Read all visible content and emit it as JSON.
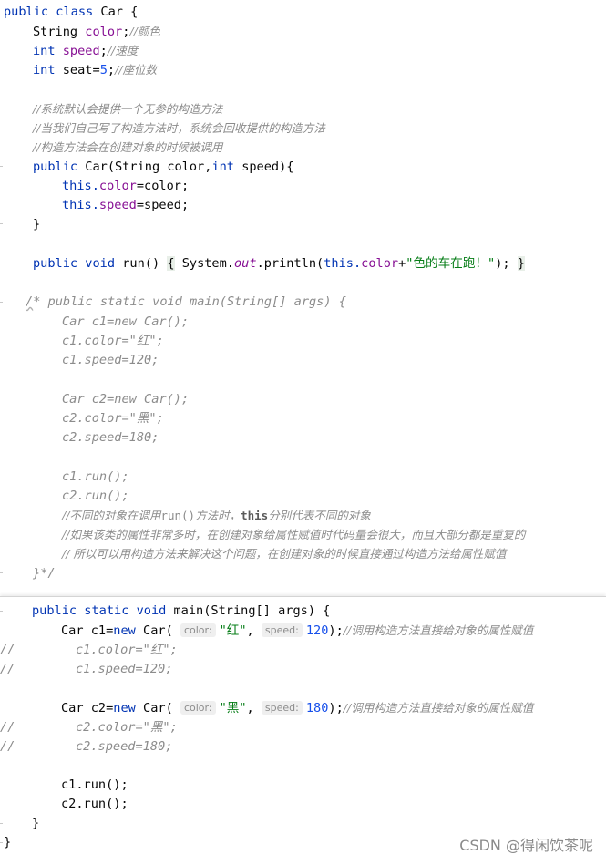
{
  "top": {
    "l1": {
      "a": "public class ",
      "b": "Car {"
    },
    "l2": {
      "a": "String ",
      "b": "color",
      "c": ";",
      "d": "//颜色"
    },
    "l3": {
      "a": "int ",
      "b": "speed",
      "c": ";",
      "d": "//速度"
    },
    "l4": {
      "a": "int ",
      "b": "seat",
      "c": "=",
      "d": "5",
      "e": ";",
      "f": "//座位数"
    },
    "l5": "//系统默认会提供一个无参的构造方法",
    "l6": "//当我们自己写了构造方法时，系统会回收提供的构造方法",
    "l7": "//构造方法会在创建对象的时候被调用",
    "l8": {
      "a": "public ",
      "b": "Car(String color,",
      "c": "int ",
      "d": "speed){"
    },
    "l9": {
      "a": "this.",
      "b": "color",
      "c": "=color;"
    },
    "l10": {
      "a": "this.",
      "b": "speed",
      "c": "=speed;"
    },
    "l11": "}",
    "l12": {
      "a": "public void ",
      "b": "run() ",
      "c": "{",
      "d": " System.",
      "e": "out",
      "f": ".println(",
      "g": "this.",
      "h": "color",
      "i": "+",
      "j": "\"色的车在跑！\"",
      "k": "); ",
      "l": "}"
    },
    "l13": {
      "a": "/",
      "b": "* public static void main(String[] args) {"
    },
    "c1": "Car c1=new Car();",
    "c2": "c1.color=\"红\";",
    "c3": "c1.speed=120;",
    "c4": "Car c2=new Car();",
    "c5": "c2.color=\"黑\";",
    "c6": "c2.speed=180;",
    "c7": "c1.run();",
    "c8": "c2.run();",
    "c9": {
      "a": "//不同的对象在调用",
      "b": "run()",
      "c": "方法时，",
      "d": "this",
      "e": "分别代表不同的对象"
    },
    "c10": "//如果该类的属性非常多时，在创建对象给属性赋值时代码量会很大，而且大部分都是重复的",
    "c11": "// 所以可以用构造方法来解决这个问题，在创建对象的时候直接通过构造方法给属性赋值",
    "c12": "}*/"
  },
  "bottom": {
    "b1": {
      "a": "public static void ",
      "b": "main(String[] args) {"
    },
    "b2": {
      "a": "Car c1=",
      "b": "new ",
      "c": "Car( ",
      "h1": "color:",
      "d": "\"红\"",
      "e": ", ",
      "h2": "speed:",
      "f": "120",
      "g": ");",
      "cm": "//调用构造方法直接给对象的属性赋值"
    },
    "b3": {
      "slash": "//",
      "t": "c1.color=\"红\";"
    },
    "b4": {
      "slash": "//",
      "t": "c1.speed=120;"
    },
    "b5": {
      "a": "Car c2=",
      "b": "new ",
      "c": "Car( ",
      "h1": "color:",
      "d": "\"黑\"",
      "e": ", ",
      "h2": "speed:",
      "f": "180",
      "g": ");",
      "cm": "//调用构造方法直接给对象的属性赋值"
    },
    "b6": {
      "slash": "//",
      "t": "c2.color=\"黑\";"
    },
    "b7": {
      "slash": "//",
      "t": "c2.speed=180;"
    },
    "b8": "c1.run();",
    "b9": "c2.run();",
    "b10": "}",
    "b11": "}"
  },
  "watermark": "CSDN @得闲饮茶呢"
}
